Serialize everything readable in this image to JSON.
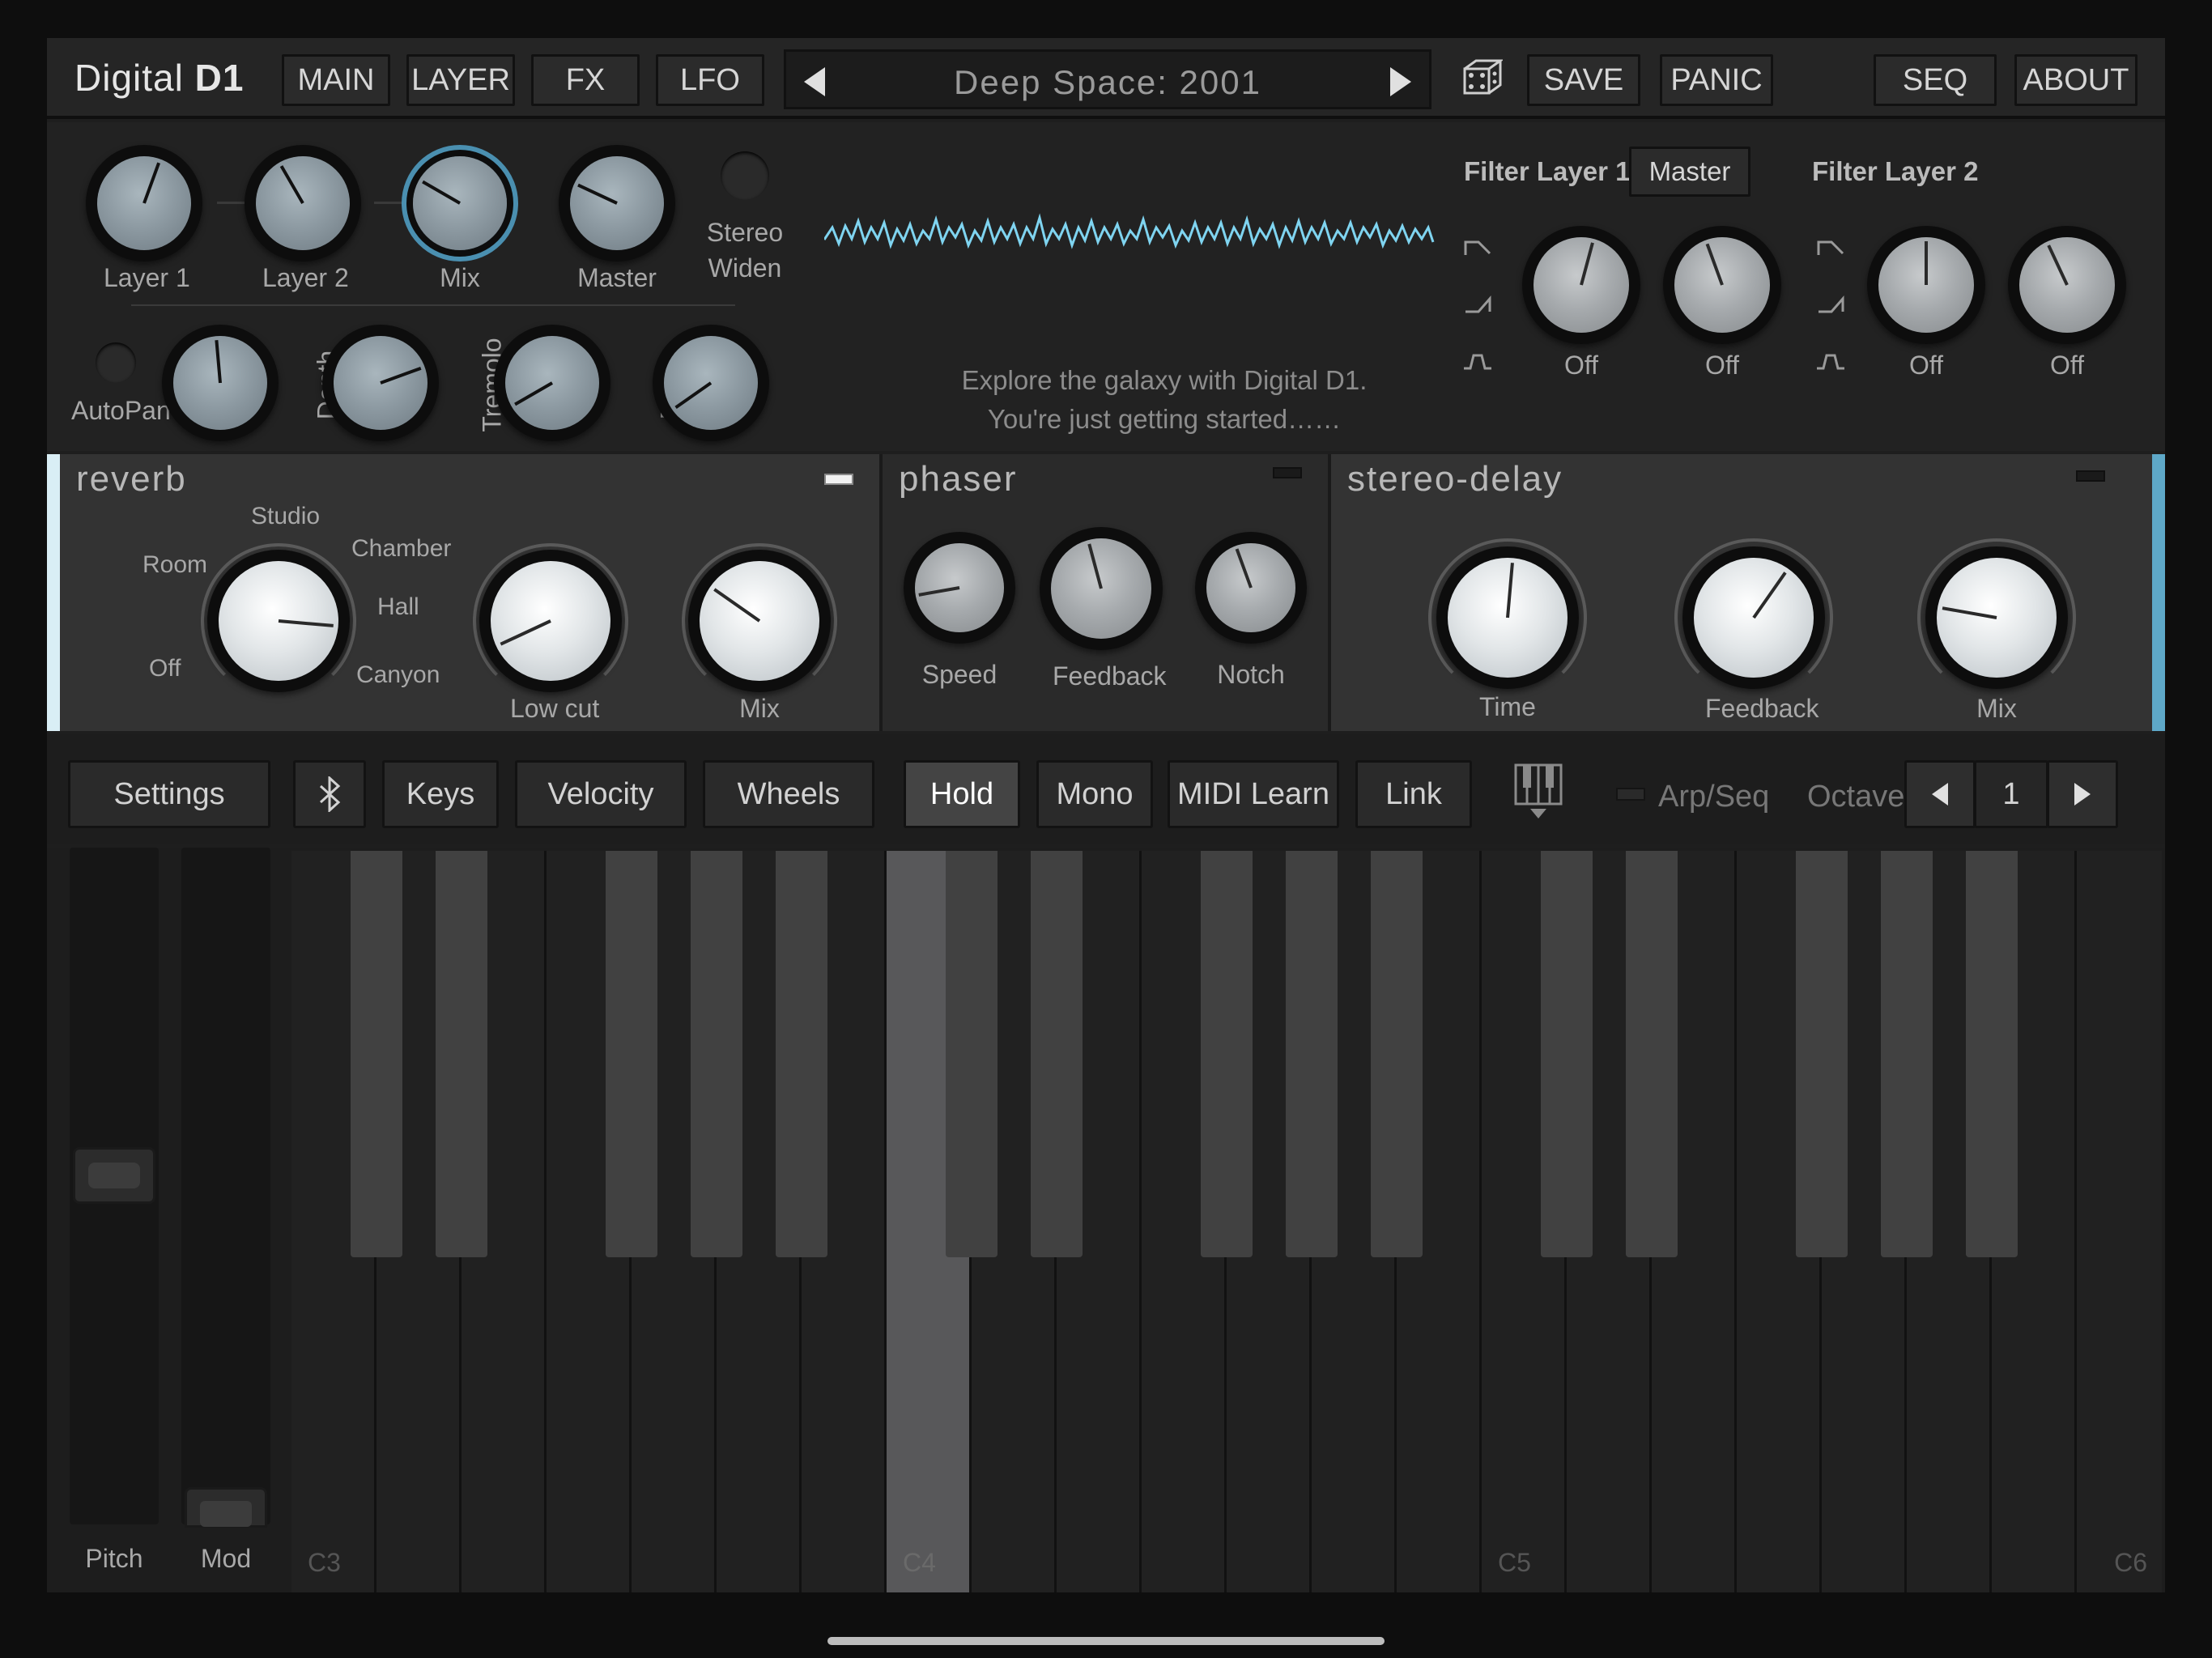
{
  "app": {
    "logo_prefix": "Digital",
    "logo_suffix": "D1"
  },
  "nav": {
    "main": "MAIN",
    "layer": "LAYER",
    "fx": "FX",
    "lfo": "LFO",
    "save": "SAVE",
    "panic": "PANIC",
    "seq": "SEQ",
    "about": "ABOUT"
  },
  "preset": {
    "name": "Deep Space: 2001"
  },
  "mixer": {
    "layer1": "Layer 1",
    "layer2": "Layer 2",
    "mix": "Mix",
    "master": "Master",
    "stereo": "Stereo",
    "widen": "Widen",
    "autopan": "AutoPan",
    "depth1": "Depth",
    "tremolo": "Tremolo",
    "depth2": "Depth"
  },
  "message": {
    "line1": "Explore the galaxy with Digital D1.",
    "line2": "You're just getting started……"
  },
  "filters": {
    "layer1_title": "Filter Layer 1",
    "master_button": "Master",
    "layer2_title": "Filter Layer 2",
    "k1": "Off",
    "k2": "Off",
    "k3": "Off",
    "k4": "Off"
  },
  "reverb": {
    "title": "reverb",
    "off": "Off",
    "room": "Room",
    "studio": "Studio",
    "chamber": "Chamber",
    "hall": "Hall",
    "canyon": "Canyon",
    "lowcut": "Low cut",
    "mix": "Mix"
  },
  "phaser": {
    "title": "phaser",
    "speed": "Speed",
    "feedback": "Feedback",
    "notch": "Notch"
  },
  "delay": {
    "title": "stereo-delay",
    "time": "Time",
    "feedback": "Feedback",
    "mix": "Mix"
  },
  "controls": {
    "settings": "Settings",
    "keys": "Keys",
    "velocity": "Velocity",
    "wheels": "Wheels",
    "hold": "Hold",
    "mono": "Mono",
    "midi_learn": "MIDI Learn",
    "link": "Link",
    "arpseq": "Arp/Seq",
    "octave_label": "Octave",
    "octave_value": "1"
  },
  "wheels": {
    "pitch": "Pitch",
    "mod": "Mod"
  },
  "keyboard": {
    "c3": "C3",
    "c4": "C4",
    "c5": "C5",
    "c6": "C6"
  },
  "colors": {
    "accent": "#6fc3df",
    "waveform": "#7fd4f0"
  }
}
